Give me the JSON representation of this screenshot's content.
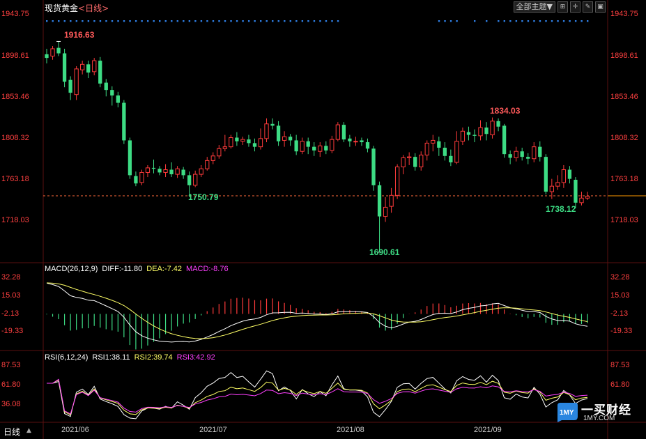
{
  "header": {
    "instrument": "现货黄金",
    "period": "<日线>",
    "theme_button": "全部主题▼"
  },
  "toolbar_icons": [
    "expand-icon",
    "crosshair-icon",
    "draw-icon",
    "window-icon"
  ],
  "price_axis": {
    "labels": [
      "1943.75",
      "1898.61",
      "1853.46",
      "1808.32",
      "1763.18",
      "1718.03"
    ]
  },
  "macd": {
    "header": "MACD(26,12,9)",
    "diff": "DIFF:-11.80",
    "dea": "DEA:-7.42",
    "macd": "MACD:-8.76",
    "axis_labels": [
      "32.28",
      "15.03",
      "-2.13",
      "-19.33"
    ]
  },
  "rsi": {
    "header": "RSI(6,12,24)",
    "rsi1": "RSI1:38.11",
    "rsi2": "RSI2:39.74",
    "rsi3": "RSI3:42.92",
    "axis_labels": [
      "87.53",
      "61.80",
      "36.08"
    ]
  },
  "x_labels": [
    "2021/06",
    "2021/07",
    "2021/08",
    "2021/09"
  ],
  "period_tab": "日线",
  "annotations": {
    "high1": "1916.63",
    "low1": "1750.79",
    "low2": "1690.61",
    "high2": "1834.03",
    "low3": "1738.12"
  },
  "watermark": {
    "name": "一买财经",
    "site": "1MY.COM",
    "logo_text": "1MY"
  },
  "colors": {
    "up": "#ff3b3b",
    "down": "#3ddc84",
    "diff": "#ffffff",
    "dea": "#ffff66",
    "macd_label": "#ff40ff",
    "rsi1": "#ffffff",
    "rsi2": "#ffff66",
    "rsi3": "#ff40ff",
    "axis": "#ff4040",
    "current_price_line": "#ff6a3d"
  },
  "chart_data": {
    "type": "candlestick",
    "price_range": [
      1680,
      1950
    ],
    "current_price": 1751.5,
    "candles": [
      [
        1906,
        1902,
        1912,
        1896
      ],
      [
        1904,
        1912,
        1915,
        1900
      ],
      [
        1913,
        1907,
        1920,
        1904
      ],
      [
        1907,
        1876,
        1912,
        1870
      ],
      [
        1878,
        1864,
        1882,
        1856
      ],
      [
        1862,
        1890,
        1893,
        1856
      ],
      [
        1889,
        1895,
        1899,
        1884
      ],
      [
        1895,
        1886,
        1899,
        1880
      ],
      [
        1887,
        1899,
        1902,
        1883
      ],
      [
        1899,
        1874,
        1903,
        1870
      ],
      [
        1875,
        1867,
        1879,
        1860
      ],
      [
        1867,
        1861,
        1871,
        1850
      ],
      [
        1861,
        1853,
        1865,
        1848
      ],
      [
        1853,
        1812,
        1856,
        1808
      ],
      [
        1812,
        1774,
        1815,
        1770
      ],
      [
        1773,
        1765,
        1778,
        1762
      ],
      [
        1766,
        1777,
        1780,
        1763
      ],
      [
        1777,
        1782,
        1785,
        1772
      ],
      [
        1782,
        1781,
        1791,
        1776
      ],
      [
        1781,
        1777,
        1784,
        1774
      ],
      [
        1777,
        1780,
        1786,
        1772
      ],
      [
        1780,
        1775,
        1788,
        1772
      ],
      [
        1775,
        1781,
        1784,
        1771
      ],
      [
        1780,
        1774,
        1783,
        1770
      ],
      [
        1774,
        1763,
        1778,
        1750
      ],
      [
        1763,
        1775,
        1779,
        1761
      ],
      [
        1775,
        1781,
        1785,
        1772
      ],
      [
        1781,
        1790,
        1794,
        1779
      ],
      [
        1790,
        1795,
        1799,
        1786
      ],
      [
        1795,
        1803,
        1807,
        1792
      ],
      [
        1803,
        1805,
        1818,
        1800
      ],
      [
        1805,
        1815,
        1818,
        1803
      ],
      [
        1815,
        1811,
        1821,
        1806
      ],
      [
        1811,
        1813,
        1816,
        1807
      ],
      [
        1813,
        1809,
        1818,
        1805
      ],
      [
        1809,
        1805,
        1814,
        1800
      ],
      [
        1805,
        1814,
        1825,
        1802
      ],
      [
        1814,
        1830,
        1836,
        1810
      ],
      [
        1830,
        1828,
        1836,
        1824
      ],
      [
        1828,
        1811,
        1833,
        1806
      ],
      [
        1812,
        1816,
        1822,
        1805
      ],
      [
        1816,
        1812,
        1819,
        1806
      ],
      [
        1812,
        1800,
        1818,
        1796
      ],
      [
        1800,
        1811,
        1815,
        1797
      ],
      [
        1811,
        1805,
        1815,
        1797
      ],
      [
        1805,
        1801,
        1810,
        1795
      ],
      [
        1800,
        1806,
        1810,
        1794
      ],
      [
        1806,
        1801,
        1811,
        1797
      ],
      [
        1801,
        1813,
        1817,
        1798
      ],
      [
        1813,
        1829,
        1832,
        1811
      ],
      [
        1829,
        1813,
        1832,
        1810
      ],
      [
        1814,
        1811,
        1818,
        1805
      ],
      [
        1811,
        1811,
        1816,
        1806
      ],
      [
        1812,
        1810,
        1815,
        1806
      ],
      [
        1810,
        1803,
        1814,
        1799
      ],
      [
        1803,
        1763,
        1806,
        1757
      ],
      [
        1763,
        1729,
        1767,
        1690
      ],
      [
        1729,
        1739,
        1750,
        1723
      ],
      [
        1740,
        1752,
        1760,
        1733
      ],
      [
        1752,
        1783,
        1786,
        1748
      ],
      [
        1783,
        1793,
        1796,
        1775
      ],
      [
        1793,
        1794,
        1799,
        1785
      ],
      [
        1794,
        1783,
        1798,
        1779
      ],
      [
        1783,
        1796,
        1800,
        1779
      ],
      [
        1796,
        1809,
        1812,
        1790
      ],
      [
        1809,
        1812,
        1818,
        1800
      ],
      [
        1811,
        1804,
        1816,
        1795
      ],
      [
        1804,
        1795,
        1810,
        1790
      ],
      [
        1795,
        1788,
        1802,
        1784
      ],
      [
        1788,
        1811,
        1822,
        1786
      ],
      [
        1811,
        1822,
        1826,
        1807
      ],
      [
        1821,
        1818,
        1827,
        1812
      ],
      [
        1818,
        1817,
        1824,
        1810
      ],
      [
        1817,
        1826,
        1834,
        1812
      ],
      [
        1826,
        1819,
        1832,
        1812
      ],
      [
        1818,
        1833,
        1837,
        1814
      ],
      [
        1833,
        1827,
        1836,
        1822
      ],
      [
        1828,
        1797,
        1830,
        1793
      ],
      [
        1797,
        1793,
        1801,
        1786
      ],
      [
        1793,
        1800,
        1805,
        1789
      ],
      [
        1800,
        1794,
        1804,
        1790
      ],
      [
        1794,
        1792,
        1798,
        1786
      ],
      [
        1792,
        1805,
        1810,
        1788
      ],
      [
        1805,
        1794,
        1811,
        1789
      ],
      [
        1794,
        1756,
        1797,
        1753
      ],
      [
        1756,
        1762,
        1770,
        1748
      ],
      [
        1762,
        1766,
        1774,
        1758
      ],
      [
        1766,
        1780,
        1785,
        1760
      ],
      [
        1780,
        1770,
        1784,
        1765
      ],
      [
        1769,
        1744,
        1772,
        1738
      ],
      [
        1744,
        1749,
        1756,
        1741
      ],
      [
        1749,
        1751,
        1756,
        1747
      ]
    ],
    "macd": {
      "diff_start": 29.5,
      "dea_start": 29.8,
      "diff_end": -11.8,
      "dea_end": -7.42,
      "hist_end": -8.76
    },
    "rsi": {
      "rsi1_end": 38.11,
      "rsi2_end": 39.74,
      "rsi3_end": 42.92
    },
    "x_categories": [
      "2021/06",
      "2021/07",
      "2021/08",
      "2021/09"
    ]
  }
}
